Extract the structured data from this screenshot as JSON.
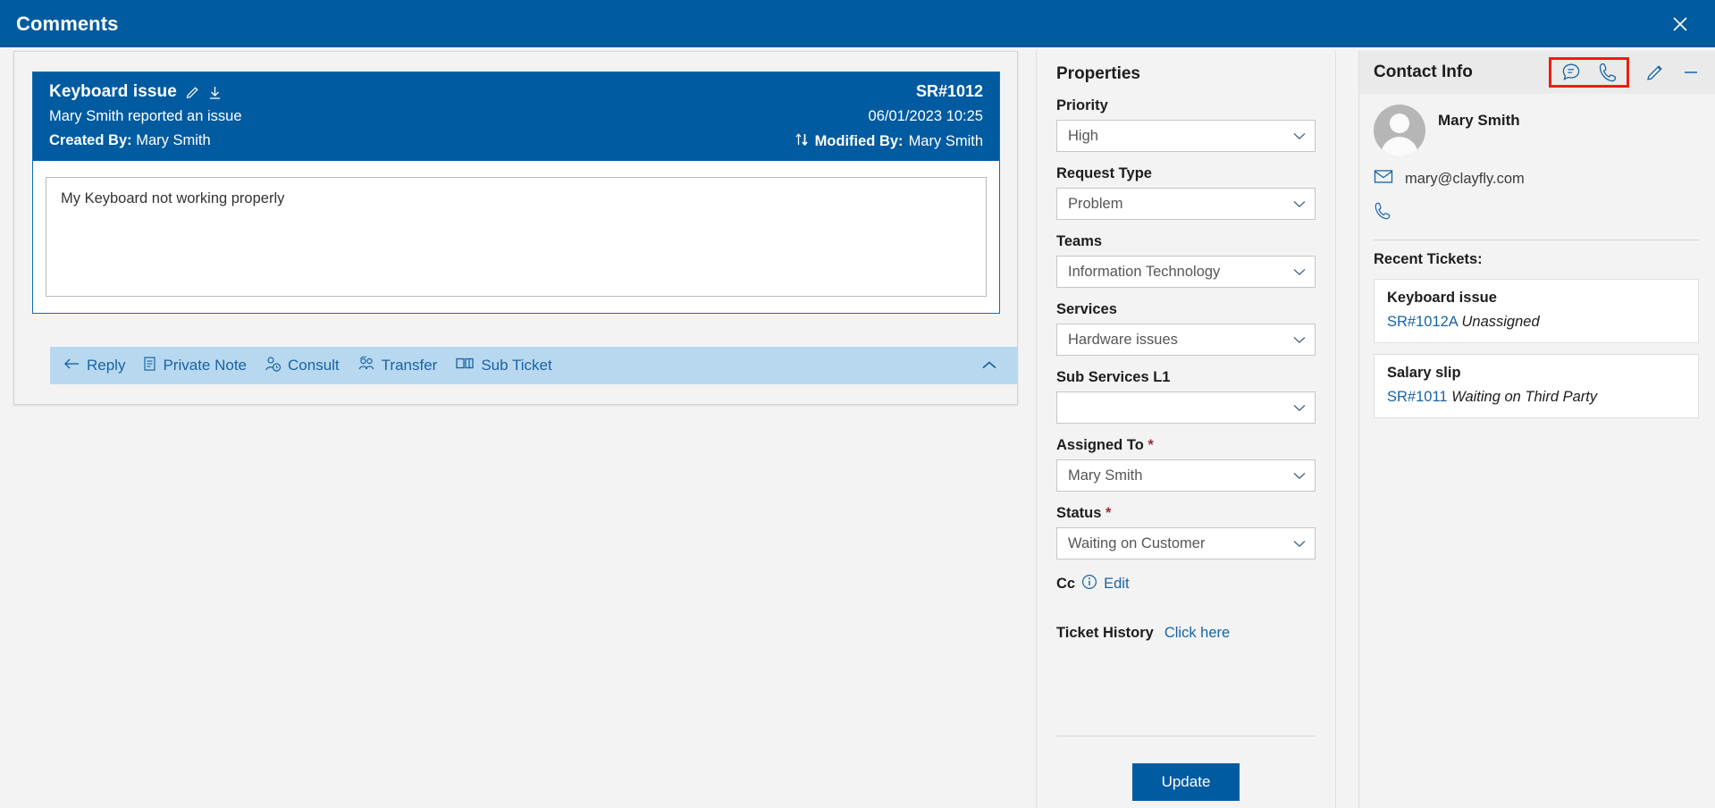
{
  "window": {
    "title": "Comments",
    "close_icon": "close-icon"
  },
  "ticket": {
    "title": "Keyboard issue",
    "edit_icon": "pencil-icon",
    "download_icon": "download-icon",
    "subtitle": "Mary Smith reported an issue",
    "created_by_label": "Created By:",
    "created_by_value": "Mary Smith",
    "id": "SR#1012",
    "datetime": "06/01/2023 10:25",
    "sort_icon": "sort-arrows-icon",
    "modified_by_label": "Modified By:",
    "modified_by_value": "Mary Smith",
    "message": "My Keyboard not working properly"
  },
  "actions": {
    "items": [
      {
        "label": "Reply",
        "icon": "reply-arrow-icon"
      },
      {
        "label": "Private Note",
        "icon": "note-icon"
      },
      {
        "label": "Consult",
        "icon": "person-clock-icon"
      },
      {
        "label": "Transfer",
        "icon": "transfer-people-icon"
      },
      {
        "label": "Sub Ticket",
        "icon": "columns-icon"
      }
    ],
    "collapse_icon": "chevron-up-icon"
  },
  "properties": {
    "title": "Properties",
    "fields": [
      {
        "label": "Priority",
        "value": "High",
        "required": false
      },
      {
        "label": "Request Type",
        "value": "Problem",
        "required": false
      },
      {
        "label": "Teams",
        "value": "Information Technology",
        "required": false
      },
      {
        "label": "Services",
        "value": "Hardware issues",
        "required": false
      },
      {
        "label": "Sub Services L1",
        "value": "",
        "required": false
      },
      {
        "label": "Assigned To",
        "value": "Mary Smith",
        "required": true
      },
      {
        "label": "Status",
        "value": "Waiting on Customer",
        "required": true
      }
    ],
    "cc_label": "Cc",
    "cc_info_icon": "info-icon",
    "cc_edit_label": "Edit",
    "history_label": "Ticket History",
    "history_link": "Click here",
    "update_button": "Update",
    "required_marker": "*"
  },
  "contact": {
    "title": "Contact Info",
    "header_icons": [
      {
        "name": "chat-icon",
        "highlighted": true
      },
      {
        "name": "phone-icon",
        "highlighted": true
      },
      {
        "name": "edit-pencil-icon",
        "highlighted": false
      },
      {
        "name": "minimize-icon",
        "highlighted": false
      }
    ],
    "name": "Mary Smith",
    "email": "mary@clayfly.com",
    "email_icon": "envelope-icon",
    "phone": "",
    "phone_icon": "phone-icon",
    "recent_label": "Recent Tickets:",
    "recent_tickets": [
      {
        "title": "Keyboard issue",
        "id": "SR#1012A",
        "status": "Unassigned"
      },
      {
        "title": "Salary slip",
        "id": "SR#1011",
        "status": "Waiting on Third Party"
      }
    ]
  },
  "colors": {
    "brand_blue": "#015ba0",
    "link_blue": "#1763a6",
    "action_bar": "#b8d8ef",
    "highlight_red": "#ee1c12",
    "panel_bg": "#f3f3f3"
  }
}
